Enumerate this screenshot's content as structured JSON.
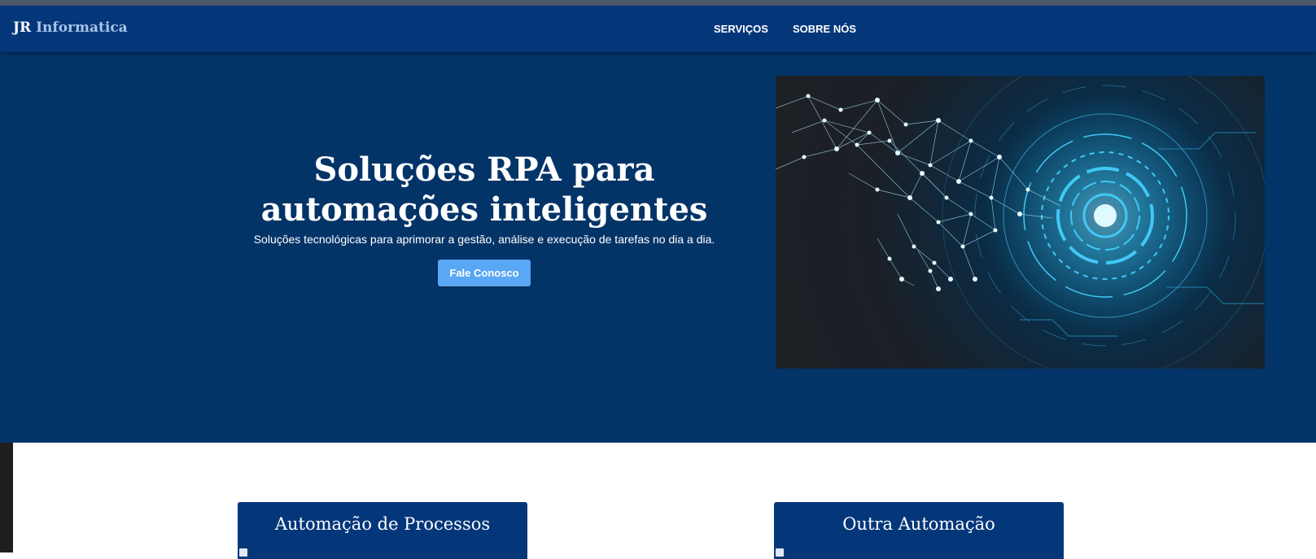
{
  "brand": {
    "name_part1": "JR",
    "name_part2": "Informatica"
  },
  "nav": {
    "items": [
      {
        "label": "SERVIÇOS"
      },
      {
        "label": "SOBRE NÓS"
      }
    ]
  },
  "hero": {
    "title": "Soluções RPA para automações inteligentes",
    "subtitle": "Soluções tecnológicas para aprimorar a gestão, análise e execução de tarefas no dia a dia.",
    "cta_label": "Fale Conosco"
  },
  "cards": [
    {
      "title": "Automação de Processos"
    },
    {
      "title": "Outra Automação"
    }
  ],
  "colors": {
    "navbar": "#04377a",
    "hero_background": "#033468",
    "cta_button": "#5aa7f5",
    "card_header": "#04377a"
  }
}
